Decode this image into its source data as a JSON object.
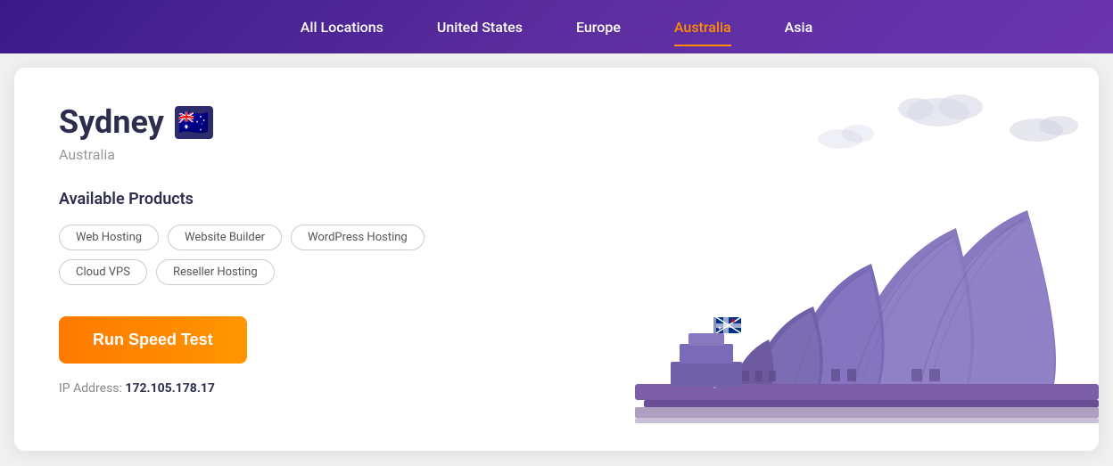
{
  "nav": {
    "items": [
      {
        "id": "all-locations",
        "label": "All Locations",
        "active": false
      },
      {
        "id": "united-states",
        "label": "United States",
        "active": false
      },
      {
        "id": "europe",
        "label": "Europe",
        "active": false
      },
      {
        "id": "australia",
        "label": "Australia",
        "active": true
      },
      {
        "id": "asia",
        "label": "Asia",
        "active": false
      }
    ]
  },
  "location": {
    "city": "Sydney",
    "country": "Australia",
    "flag_emoji": "🇦🇺",
    "ip_label": "IP Address:",
    "ip_value": "172.105.178.17"
  },
  "products": {
    "title": "Available Products",
    "items": [
      {
        "label": "Web Hosting"
      },
      {
        "label": "Website Builder"
      },
      {
        "label": "WordPress Hosting"
      },
      {
        "label": "Cloud VPS"
      },
      {
        "label": "Reseller Hosting"
      }
    ]
  },
  "speed_test": {
    "button_label": "Run Speed Test"
  },
  "colors": {
    "nav_bg_start": "#3a1a8a",
    "nav_bg_end": "#6b35b0",
    "active_tab": "#ff8c00",
    "button_bg": "#ff7a00",
    "city_color": "#2d2d4e",
    "country_color": "#999999"
  }
}
